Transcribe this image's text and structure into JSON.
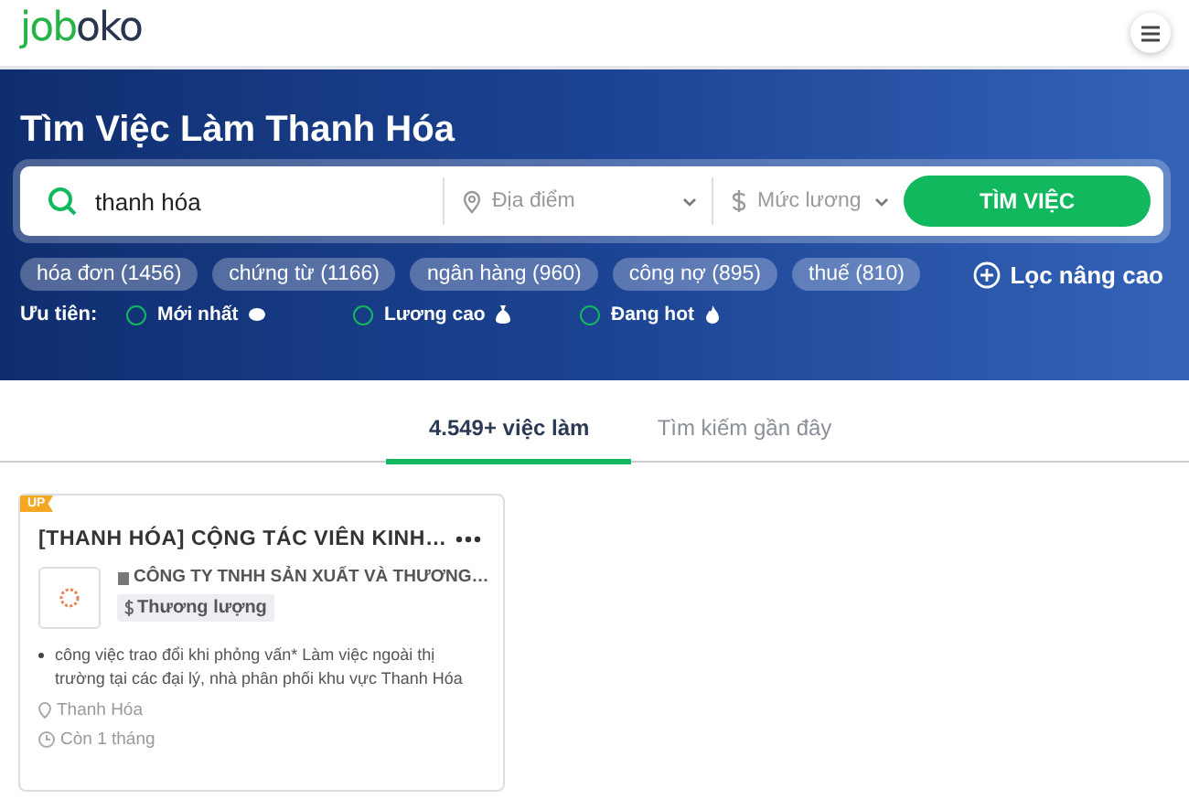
{
  "header": {
    "logo_parts": [
      "job",
      "oko"
    ]
  },
  "hero": {
    "title": "Tìm Việc Làm Thanh Hóa",
    "search": {
      "value": "thanh hóa",
      "location_placeholder": "Địa điểm",
      "salary_placeholder": "Mức lương",
      "button": "TÌM VIỆC"
    },
    "tags": [
      {
        "label": "hóa đơn (1456)"
      },
      {
        "label": "chứng từ (1166)"
      },
      {
        "label": "ngân hàng (960)"
      },
      {
        "label": "công nợ (895)"
      },
      {
        "label": "thuế (810)"
      }
    ],
    "advanced_filter": "Lọc nâng cao",
    "priority": {
      "label": "Ưu tiên:",
      "options": [
        {
          "label": "Mới nhất",
          "kind": "new",
          "checked": false
        },
        {
          "label": "Lương cao",
          "kind": "money",
          "checked": false
        },
        {
          "label": "Đang hot",
          "kind": "hot",
          "checked": false
        }
      ]
    }
  },
  "tabs": [
    {
      "label": "4.549+ việc làm",
      "selected": true
    },
    {
      "label": "Tìm kiếm gần đây",
      "selected": false
    }
  ],
  "jobs": [
    {
      "badge": "UP",
      "title": "[THANH HÓA] CỘNG TÁC VIÊN KINH…",
      "company": "CÔNG TY TNHH SẢN XUẤT VÀ THƯƠNG…",
      "salary": "Thương lượng",
      "description": "công việc trao đổi khi phỏng vấn* Làm việc ngoài thị trường tại các đại lý, nhà phân phối khu vực Thanh Hóa",
      "location": "Thanh Hóa",
      "deadline": "Còn 1 tháng"
    }
  ]
}
